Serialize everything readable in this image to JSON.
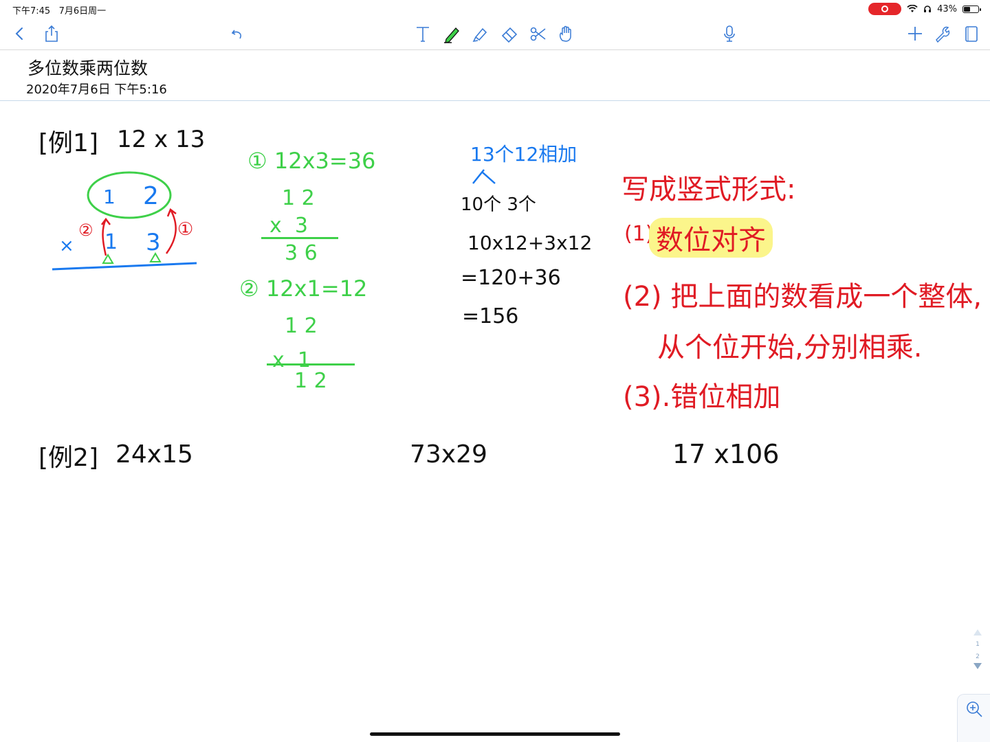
{
  "status_bar": {
    "time": "下午7:45",
    "date": "7月6日周一",
    "battery": "43%",
    "battery_level": 0.43
  },
  "toolbar": {
    "icons": [
      "back-icon",
      "share-icon",
      "undo-icon",
      "text-icon",
      "pen-icon",
      "highlighter-icon",
      "eraser-icon",
      "lasso-scissors-icon",
      "hand-icon",
      "microphone-icon",
      "add-icon",
      "wrench-icon",
      "device-icon"
    ]
  },
  "note": {
    "title": "多位数乘两位数",
    "date": "2020年7月6日 下午5:16"
  },
  "handwriting": {
    "example1": {
      "label": "[例1]",
      "expr": "12 x 13"
    },
    "diagram": {
      "top_digit_1": "1",
      "top_digit_2": "2",
      "times_sign": "×",
      "bottom_digit_1": "1",
      "bottom_digit_2": "3",
      "circle_2": "②",
      "circle_1": "①"
    },
    "step1": {
      "line": "① 12x3=36",
      "row1": "1 2",
      "row2": "x  3",
      "result": "3 6"
    },
    "step2": {
      "line": "② 12x1=12",
      "row1": "1 2",
      "row2": "x  1",
      "result": "1 2"
    },
    "blue_note": {
      "line1": "13个12相加",
      "line2": "10个 3个"
    },
    "calc": {
      "line1": "10x12+3x12",
      "line2": "=120+36",
      "line3": "=156"
    },
    "red_notes": {
      "heading": "写成竖式形式:",
      "item1_num": "(1).",
      "item1_text": "数位对齐",
      "item2_line1": "(2) 把上面的数看成一个整体,",
      "item2_line2": "从个位开始,分别相乘.",
      "item3": "(3).错位相加"
    },
    "example2": {
      "label": "[例2]",
      "expr": "24x15"
    },
    "exercise2": "73x29",
    "exercise3": "17 x106"
  },
  "pager": {
    "page_current": "1",
    "page_next": "2"
  },
  "colors": {
    "green": "#3ed049",
    "blue": "#1979ef",
    "red": "#e01b24",
    "highlight": "#fbf58b",
    "toolbar_icon": "#3a7bd5"
  }
}
